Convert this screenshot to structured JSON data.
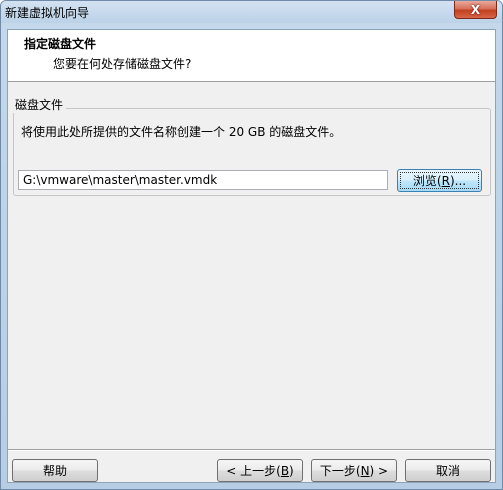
{
  "window": {
    "title": "新建虚拟机向导",
    "close_glyph": "X"
  },
  "header": {
    "title": "指定磁盘文件",
    "subtitle": "您要在何处存储磁盘文件?"
  },
  "disk_file_group": {
    "legend": "磁盘文件",
    "description": "将使用此处所提供的文件名称创建一个 20 GB 的磁盘文件。",
    "path_value": "G:\\vmware\\master\\master.vmdk",
    "browse_button": {
      "label_before": "浏览(",
      "mnemonic": "R",
      "label_after": ")..."
    }
  },
  "footer": {
    "help_label": "帮助",
    "back_button": {
      "label_before": "< 上一步(",
      "mnemonic": "B",
      "label_after": ")"
    },
    "next_button": {
      "label_before": "下一步(",
      "mnemonic": "N",
      "label_after": ") >"
    },
    "cancel_label": "取消"
  },
  "icons": {
    "close": "close-icon"
  }
}
